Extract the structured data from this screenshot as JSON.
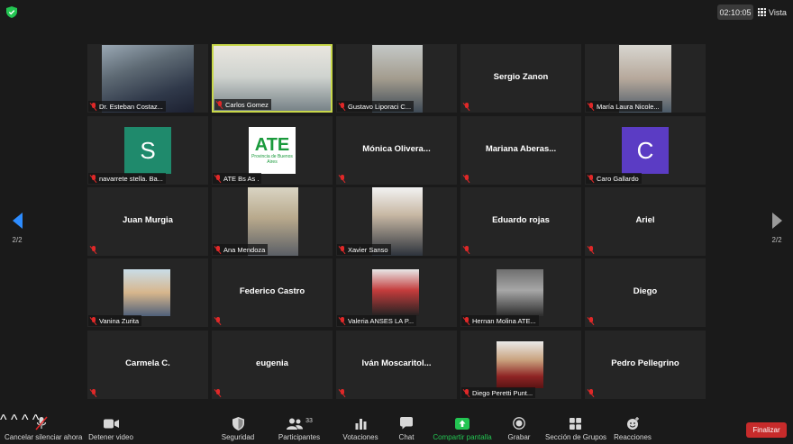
{
  "header": {
    "timer": "02:10:05",
    "view_label": "Vista"
  },
  "pagination": {
    "left": "2/2",
    "right": "2/2"
  },
  "participants": [
    {
      "name": "Dr. Esteban Costaz...",
      "type": "video"
    },
    {
      "name": "Carlos Gomez",
      "type": "video",
      "active": true
    },
    {
      "name": "Gustavo Liporaci C...",
      "type": "video"
    },
    {
      "name": "Sergio Zanon",
      "type": "name"
    },
    {
      "name": "María Laura Nicole...",
      "type": "video"
    },
    {
      "name": "navarrete stella. Ba...",
      "type": "avatar",
      "letter": "S",
      "color": "#1f8a6c"
    },
    {
      "name": "ATE Bs As .",
      "type": "logo",
      "logo_text": "ATE",
      "logo_sub": "Provincia de Buenos Aires"
    },
    {
      "name": "Mónica  Olivera...",
      "type": "name"
    },
    {
      "name": "Mariana  Aberas...",
      "type": "name"
    },
    {
      "name": "Caro Gallardo",
      "type": "avatar",
      "letter": "C",
      "color": "#5b3cc4"
    },
    {
      "name": "Juan Murgia",
      "type": "name"
    },
    {
      "name": "Ana Mendoza",
      "type": "video"
    },
    {
      "name": "Xavier Sanso",
      "type": "video"
    },
    {
      "name": "Eduardo rojas",
      "type": "name"
    },
    {
      "name": "Ariel",
      "type": "name"
    },
    {
      "name": "Vanina Zurita",
      "type": "photo"
    },
    {
      "name": "Federico Castro",
      "type": "name"
    },
    {
      "name": "Valeria ANSES LA P...",
      "type": "photo"
    },
    {
      "name": "Hernan Molina ATE...",
      "type": "photo"
    },
    {
      "name": "Diego",
      "type": "name"
    },
    {
      "name": "Carmela C.",
      "type": "name"
    },
    {
      "name": "eugenia",
      "type": "name"
    },
    {
      "name": "Iván  Moscaritol...",
      "type": "name"
    },
    {
      "name": "Diego Peretti Punt...",
      "type": "photo"
    },
    {
      "name": "Pedro Pellegrino",
      "type": "name"
    }
  ],
  "toolbar": {
    "mute": "Cancelar silenciar ahora",
    "video": "Detener video",
    "security": "Seguridad",
    "participants": "Participantes",
    "participants_count": "33",
    "polls": "Votaciones",
    "chat": "Chat",
    "share": "Compartir pantalla",
    "record": "Grabar",
    "breakout": "Sección de Grupos",
    "reactions": "Reacciones",
    "end": "Finalizar"
  },
  "colors": {
    "accent": "#2d8cff",
    "share_green": "#23c552",
    "end_red": "#c72b2b",
    "active_border": "#c8d84a"
  }
}
